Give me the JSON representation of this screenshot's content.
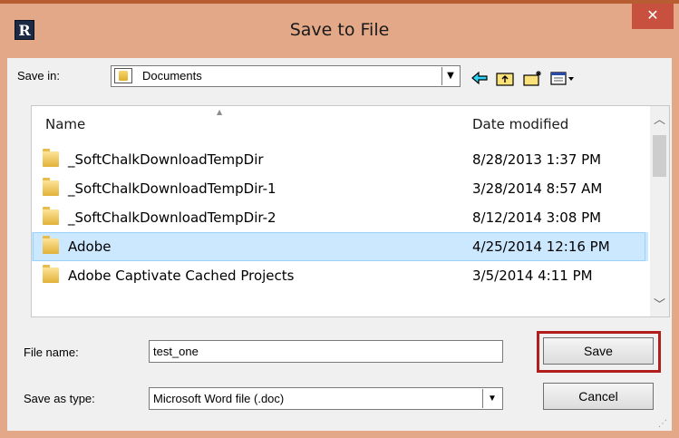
{
  "window": {
    "title": "Save to File",
    "app_icon_letter": "R",
    "close_glyph": "✕"
  },
  "toolbar": {
    "save_in_label": "Save in:",
    "save_in_value": "Documents",
    "dropdown_glyph": "▼",
    "icons": [
      "back-arrow-icon",
      "up-folder-icon",
      "new-folder-icon",
      "view-menu-icon"
    ]
  },
  "file_list": {
    "columns": [
      "Name",
      "Date modified"
    ],
    "rows": [
      {
        "name": "_SoftChalkDownloadTempDir",
        "date": "8/28/2013 1:37 PM"
      },
      {
        "name": "_SoftChalkDownloadTempDir-1",
        "date": "3/28/2014 8:57 AM"
      },
      {
        "name": "_SoftChalkDownloadTempDir-2",
        "date": "8/12/2014 3:08 PM"
      },
      {
        "name": "Adobe",
        "date": "4/25/2014 12:16 PM",
        "selected": true
      },
      {
        "name": "Adobe Captivate Cached Projects",
        "date": "3/5/2014 4:11 PM"
      }
    ]
  },
  "form": {
    "file_name_label": "File name:",
    "file_name_value": "test_one",
    "save_as_type_label": "Save as type:",
    "save_as_type_value": "Microsoft Word file (.doc)"
  },
  "buttons": {
    "save_label": "Save",
    "cancel_label": "Cancel"
  },
  "colors": {
    "title_bar": "#e2a887",
    "close_button": "#c7503f",
    "selection": "#cce8ff",
    "highlight_box": "#b01e1e"
  }
}
